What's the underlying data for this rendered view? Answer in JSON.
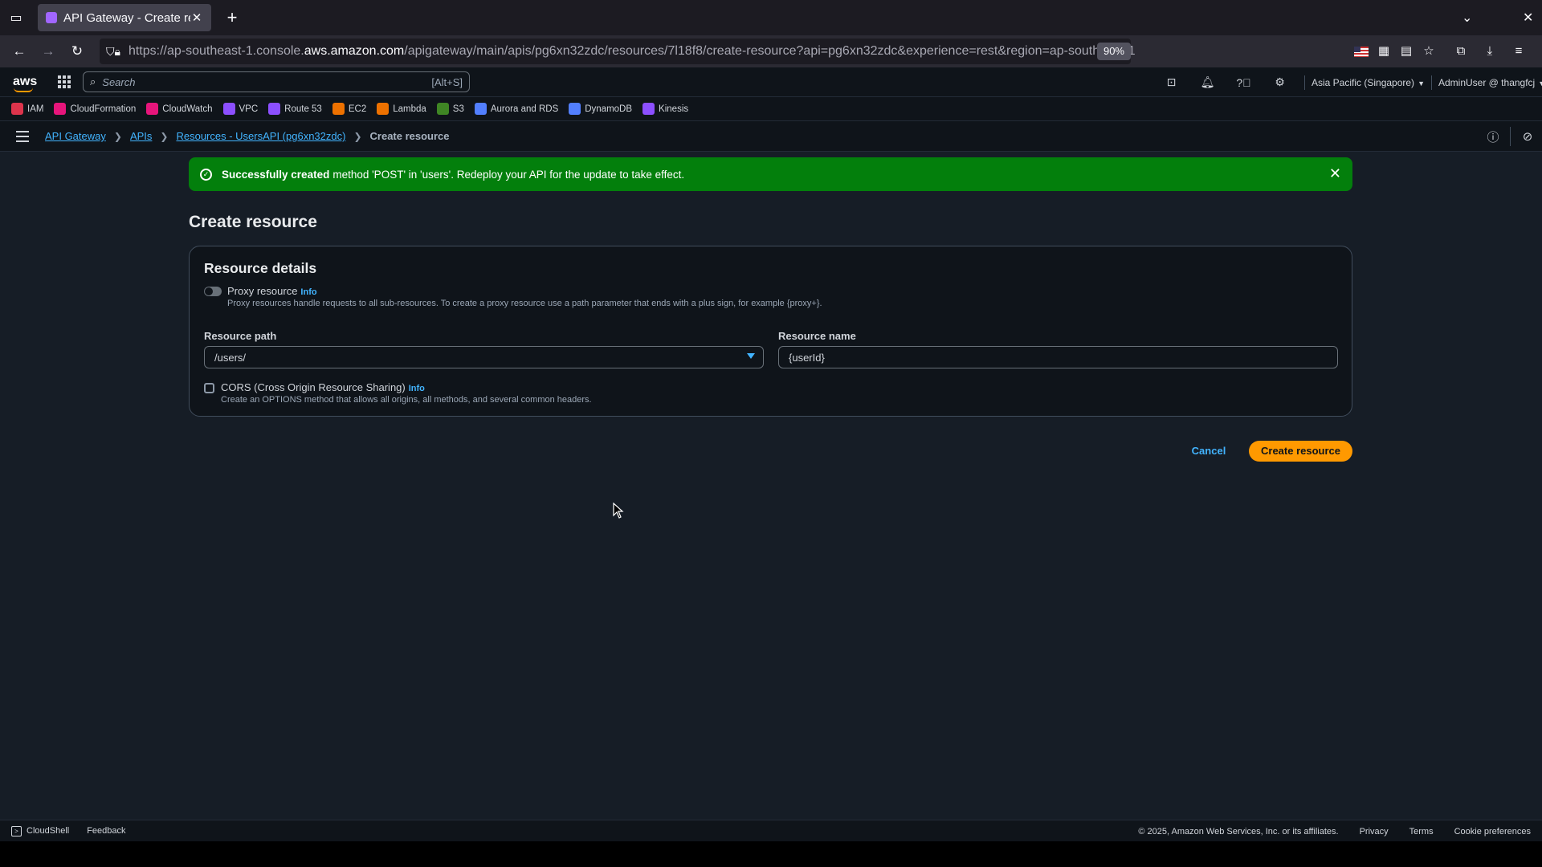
{
  "browser": {
    "tab_title": "API Gateway - Create resource",
    "url_prefix": "https://ap-southeast-1.console.",
    "url_domain": "aws.amazon.com",
    "url_suffix": "/apigateway/main/apis/pg6xn32zdc/resources/7l18f8/create-resource?api=pg6xn32zdc&experience=rest&region=ap-southeast-1",
    "zoom": "90%"
  },
  "aws_header": {
    "logo": "aws",
    "search_placeholder": "Search",
    "search_shortcut": "[Alt+S]",
    "region": "Asia Pacific (Singapore)",
    "account": "AdminUser @ thangfcj"
  },
  "favorites": [
    {
      "label": "IAM",
      "color": "#dd344c"
    },
    {
      "label": "CloudFormation",
      "color": "#e7157b"
    },
    {
      "label": "CloudWatch",
      "color": "#e7157b"
    },
    {
      "label": "VPC",
      "color": "#8c4fff"
    },
    {
      "label": "Route 53",
      "color": "#8c4fff"
    },
    {
      "label": "EC2",
      "color": "#ed7100"
    },
    {
      "label": "Lambda",
      "color": "#ed7100"
    },
    {
      "label": "S3",
      "color": "#3f8624"
    },
    {
      "label": "Aurora and RDS",
      "color": "#527fff"
    },
    {
      "label": "DynamoDB",
      "color": "#527fff"
    },
    {
      "label": "Kinesis",
      "color": "#8c4fff"
    }
  ],
  "breadcrumbs": {
    "api_gateway": "API Gateway",
    "apis": "APIs",
    "resources": "Resources - UsersAPI (pg6xn32zdc)",
    "current": "Create resource"
  },
  "flash": {
    "bold": "Successfully created",
    "message": "method 'POST' in 'users'. Redeploy your API for the update to take effect."
  },
  "page": {
    "title": "Create resource",
    "panel_title": "Resource details",
    "proxy_label": "Proxy resource",
    "info": "Info",
    "proxy_desc": "Proxy resources handle requests to all sub-resources. To create a proxy resource use a path parameter that ends with a plus sign, for example {proxy+}.",
    "resource_path_label": "Resource path",
    "resource_path_value": "/users/",
    "resource_name_label": "Resource name",
    "resource_name_value": "{userId}",
    "cors_label": "CORS (Cross Origin Resource Sharing)",
    "cors_desc": "Create an OPTIONS method that allows all origins, all methods, and several common headers.",
    "proxy_enabled": false,
    "cors_checked": false
  },
  "actions": {
    "cancel": "Cancel",
    "create": "Create resource"
  },
  "footer": {
    "cloudshell": "CloudShell",
    "feedback": "Feedback",
    "copyright": "© 2025, Amazon Web Services, Inc. or its affiliates.",
    "privacy": "Privacy",
    "terms": "Terms",
    "cookies": "Cookie preferences"
  }
}
